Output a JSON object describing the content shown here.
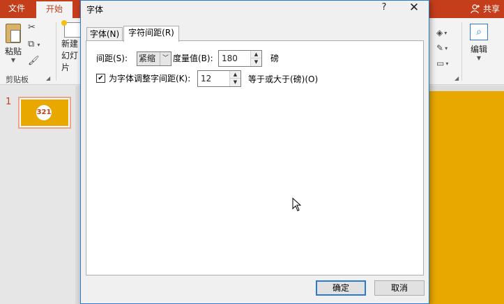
{
  "app": {
    "tabs": {
      "file": "文件",
      "home": "开始"
    },
    "share_label": "共享"
  },
  "ribbon": {
    "clipboard": {
      "paste_label": "粘贴",
      "group_label": "剪贴板"
    },
    "slides": {
      "new_slide_line1": "新建",
      "new_slide_line2": "幻灯片"
    },
    "editing": {
      "label": "编辑"
    }
  },
  "thumbnails": {
    "slide_number": "1",
    "thumb_text": "321"
  },
  "dialog": {
    "title": "字体",
    "help": "?",
    "close": "✕",
    "tabs": [
      "字体(N)",
      "字符间距(R)"
    ],
    "spacing_label": "间距(S):",
    "spacing_value": "紧缩",
    "measure_label": "度量值(B):",
    "measure_value": "180",
    "measure_unit": "磅",
    "kerning_checked": true,
    "kerning_label": "为字体调整字间距(K):",
    "kerning_value": "12",
    "kerning_suffix": "等于或大于(磅)(O)",
    "ok_label": "确定",
    "cancel_label": "取消"
  }
}
